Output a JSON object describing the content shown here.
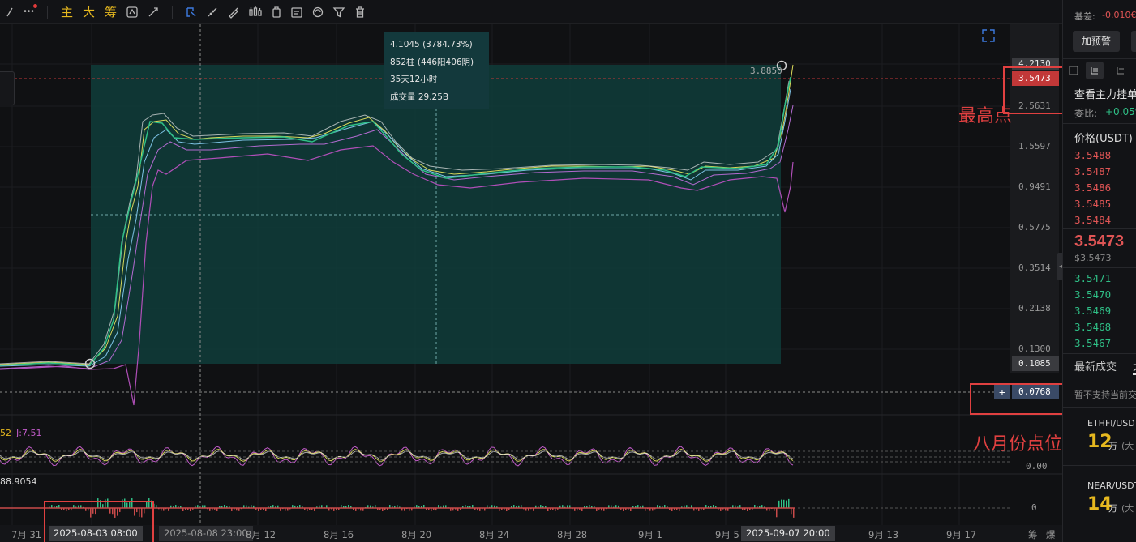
{
  "toolbar": {
    "more": "•••",
    "zh_main": "主",
    "zh_big": "大",
    "zh_chip": "筹"
  },
  "tooltip": {
    "line1": "4.1045 (3784.73%)",
    "line2": "852柱 (446阳406阴)",
    "line3": "35天12小时",
    "line4": "成交量 29.25B"
  },
  "price_axis": {
    "top_tag": "4.2130",
    "current_tag": "3.5473",
    "low_tag": "0.1085",
    "cross_tag": "0.0768",
    "cross_plus": "+",
    "ticks": [
      "2.5631",
      "1.5597",
      "0.9491",
      "0.5775",
      "0.3514",
      "0.2138",
      "0.1300"
    ],
    "high_point_label": "3.8850"
  },
  "indicator_kdj": {
    "left_label": "52",
    "j_label": "J:7.51",
    "right_label": "0.00"
  },
  "indicator_macd": {
    "left_label": "88.9054",
    "right_label": "0"
  },
  "time_axis": {
    "labels": [
      "7月 31",
      "8月 12",
      "8月 16",
      "8月 20",
      "8月 24",
      "8月 28",
      "9月 1",
      "9月 5",
      "9月 13",
      "9月 17"
    ],
    "tag_start": "2025-08-03 08:00",
    "tag_cursor": "2025-08-08 23:00",
    "tag_end": "2025-09-07 20:00",
    "right_a": "筹",
    "right_b": "爆"
  },
  "annotations": {
    "high": "最高点",
    "august": "八月份点位"
  },
  "right_panel": {
    "top_label": "基差:",
    "top_value": "-0.010€",
    "alert_button": "加预警",
    "book_title": "查看主力挂单",
    "ratio_label": "委比:",
    "ratio_value": "+0.05%",
    "price_header": "价格(USDT)",
    "asks": [
      "3.5488",
      "3.5487",
      "3.5486",
      "3.5485",
      "3.5484"
    ],
    "last_price": "3.5473",
    "last_price_usd": "$3.5473",
    "bids": [
      "3.5471",
      "3.5470",
      "3.5469",
      "3.5468",
      "3.5467"
    ],
    "trades_tab": "最新成交",
    "trades_tab2": "大",
    "unsupported": "暂不支持当前交",
    "ticker1": {
      "name": "ETHFI/USDT",
      "value": "12",
      "unit": "万",
      "extra": "(大"
    },
    "ticker2": {
      "name": "NEAR/USDT",
      "value": "14",
      "unit": "万",
      "extra": "(大"
    }
  },
  "colors": {
    "ask": "#e05555",
    "bid": "#2fbf86",
    "accent": "#e6b81f",
    "annotation": "#e04040",
    "range_box": "#0f3d3b"
  }
}
